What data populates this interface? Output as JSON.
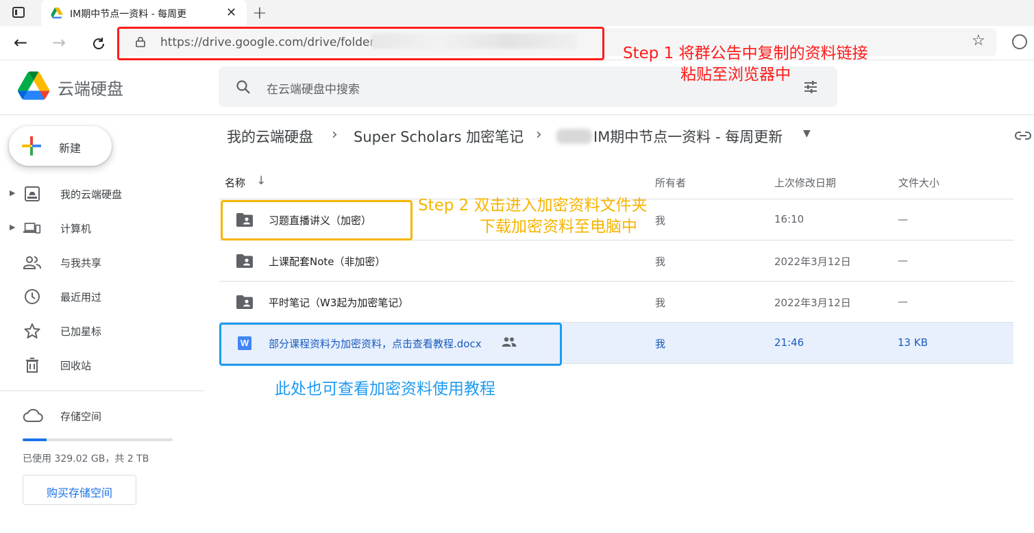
{
  "browser": {
    "tab_title": "IM期中节点一资料 - 每周更",
    "new_tab_symbol": "+",
    "url": "https://drive.google.com/drive/folders/1"
  },
  "app": {
    "name": "云端硬盘",
    "search_placeholder": "在云端硬盘中搜索"
  },
  "sidebar": {
    "new_label": "新建",
    "items": [
      {
        "label": "我的云端硬盘",
        "icon": "my-drive-icon",
        "expandable": true
      },
      {
        "label": "计算机",
        "icon": "computer-icon",
        "expandable": true
      },
      {
        "label": "与我共享",
        "icon": "shared-people-icon",
        "expandable": false
      },
      {
        "label": "最近用过",
        "icon": "clock-icon",
        "expandable": false
      },
      {
        "label": "已加星标",
        "icon": "star-icon",
        "expandable": false
      },
      {
        "label": "回收站",
        "icon": "trash-icon",
        "expandable": false
      }
    ],
    "storage_label": "存储空间",
    "storage_used_text": "已使用 329.02 GB，共 2 TB",
    "storage_used_fraction": 0.16,
    "buy_storage_label": "购买存储空间"
  },
  "breadcrumb": {
    "items": [
      "我的云端硬盘",
      "Super Scholars 加密笔记",
      "IM期中节点一资料 - 每周更新"
    ],
    "separator": "›"
  },
  "table": {
    "headers": {
      "name": "名称",
      "owner": "所有者",
      "modified": "上次修改日期",
      "size": "文件大小"
    },
    "rows": [
      {
        "name": "习题直播讲义（加密）",
        "type": "shared-folder",
        "owner": "我",
        "modified": "16:10",
        "size": "—"
      },
      {
        "name": "上课配套Note（非加密）",
        "type": "shared-folder",
        "owner": "我",
        "modified": "2022年3月12日",
        "size": "—"
      },
      {
        "name": "平时笔记（W3起为加密笔记）",
        "type": "shared-folder",
        "owner": "我",
        "modified": "2022年3月12日",
        "size": "—"
      },
      {
        "name": "部分课程资料为加密资料，点击查看教程.docx",
        "type": "word-doc",
        "owner": "我",
        "modified": "21:46",
        "size": "13 KB",
        "shared": true,
        "selected": true
      }
    ]
  },
  "annotations": {
    "step1_line1": "Step 1 将群公告中复制的资料链接",
    "step1_line2": "粘贴至浏览器中",
    "step2_line1": "Step 2  双击进入加密资料文件夹",
    "step2_line2": "下载加密资料至电脑中",
    "note": "此处也可查看加密资料使用教程",
    "colors": {
      "step1": "#ff1a1a",
      "step2": "#f5b400",
      "note": "#1e9af0"
    }
  },
  "colors": {
    "accent": "#1a73e8",
    "selected_row": "#e8f0fe"
  }
}
